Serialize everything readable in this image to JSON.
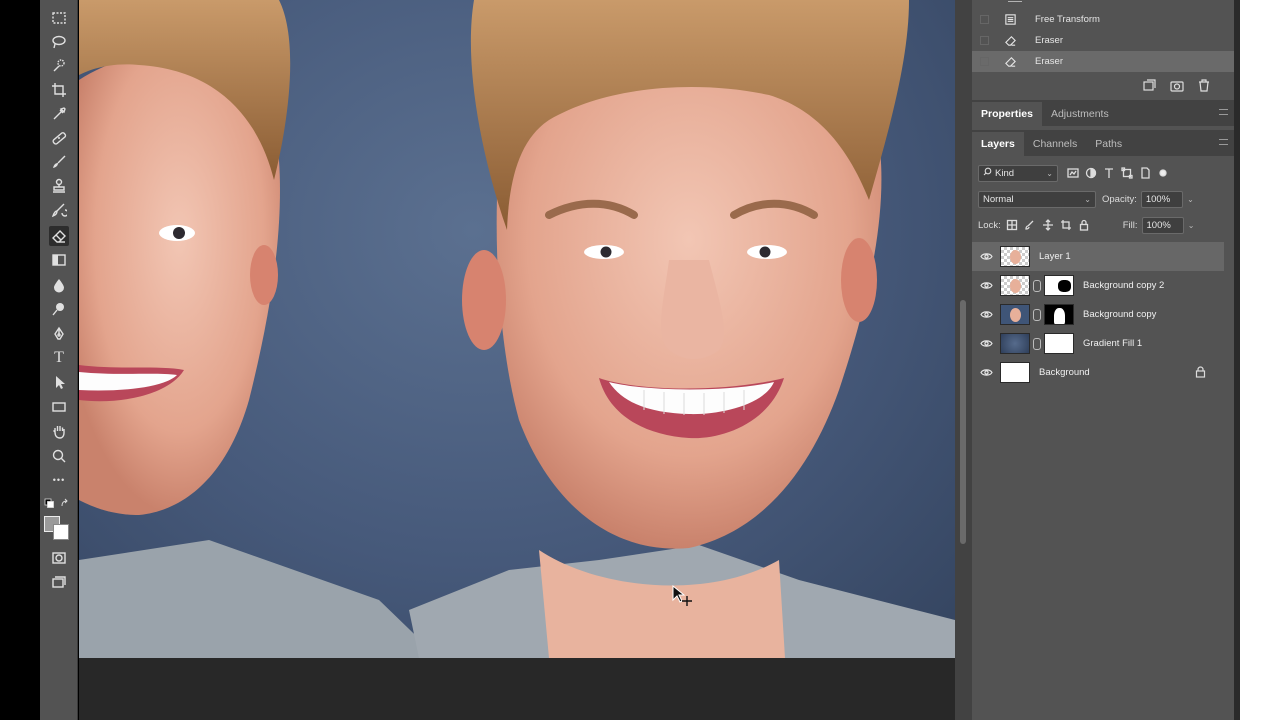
{
  "toolbar": {
    "tools": [
      {
        "name": "marquee-tool-icon"
      },
      {
        "name": "lasso-tool-icon"
      },
      {
        "name": "quick-selection-tool-icon"
      },
      {
        "name": "crop-tool-icon"
      },
      {
        "name": "eyedropper-tool-icon"
      },
      {
        "name": "healing-brush-tool-icon"
      },
      {
        "name": "brush-tool-icon"
      },
      {
        "name": "clone-stamp-tool-icon"
      },
      {
        "name": "history-brush-tool-icon"
      },
      {
        "name": "eraser-tool-icon",
        "active": true
      },
      {
        "name": "gradient-tool-icon"
      },
      {
        "name": "blur-tool-icon"
      },
      {
        "name": "dodge-tool-icon"
      },
      {
        "name": "pen-tool-icon"
      },
      {
        "name": "type-tool-icon"
      },
      {
        "name": "path-selection-tool-icon"
      },
      {
        "name": "rectangle-tool-icon"
      },
      {
        "name": "hand-tool-icon"
      },
      {
        "name": "zoom-tool-icon"
      },
      {
        "name": "more-tools-icon"
      }
    ],
    "type_glyph": "T",
    "more_glyph": "•••",
    "foreground_color": "#9a9a9a",
    "background_color": "#ffffff"
  },
  "history": {
    "items": [
      {
        "label": "Free Transform",
        "icon": "transform-icon",
        "selected": false
      },
      {
        "label": "Eraser",
        "icon": "eraser-icon",
        "selected": false
      },
      {
        "label": "Eraser",
        "icon": "eraser-icon",
        "selected": true
      }
    ]
  },
  "properties_tabs": {
    "tabs": [
      "Properties",
      "Adjustments"
    ]
  },
  "layers_panel": {
    "tabs": [
      "Layers",
      "Channels",
      "Paths"
    ],
    "filter_label": "Kind",
    "blend_mode": "Normal",
    "opacity_label": "Opacity:",
    "opacity_value": "100%",
    "lock_label": "Lock:",
    "fill_label": "Fill:",
    "fill_value": "100%",
    "layers": [
      {
        "name": "Layer 1",
        "selected": true
      },
      {
        "name": "Background copy 2",
        "selected": false
      },
      {
        "name": "Background copy",
        "selected": false
      },
      {
        "name": "Gradient Fill 1",
        "selected": false
      },
      {
        "name": "Background",
        "selected": false,
        "locked": true
      }
    ]
  },
  "colors": {
    "panel_bg": "#535353",
    "selected_row": "#676767",
    "canvas_bg": "#4a5d7d"
  }
}
